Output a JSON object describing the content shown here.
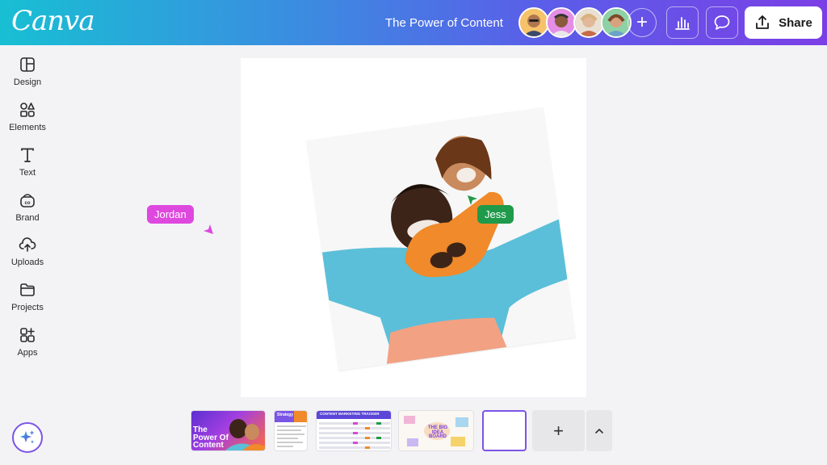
{
  "header": {
    "logo": "Canva",
    "doc_title": "The Power of Content",
    "add_collaborator": "+",
    "share_label": "Share",
    "icons": [
      "analytics-icon",
      "comment-icon",
      "upload-icon"
    ]
  },
  "collaborators": [
    {
      "ring": "#f2a13a",
      "skin": "#b0774f"
    },
    {
      "ring": "#d64bd6",
      "skin": "#8a5a3c"
    },
    {
      "ring": "#c9c2b8",
      "skin": "#e1b89a"
    },
    {
      "ring": "#1f9a4a",
      "skin": "#d9a27e"
    }
  ],
  "sidebar": {
    "items": [
      {
        "label": "Design",
        "icon": "layout-icon"
      },
      {
        "label": "Elements",
        "icon": "shapes-icon"
      },
      {
        "label": "Text",
        "icon": "text-icon"
      },
      {
        "label": "Brand",
        "icon": "brand-icon"
      },
      {
        "label": "Uploads",
        "icon": "cloud-upload-icon"
      },
      {
        "label": "Projects",
        "icon": "folder-icon"
      },
      {
        "label": "Apps",
        "icon": "apps-icon"
      }
    ],
    "magic_icon": "sparkle-icon"
  },
  "cursors": {
    "jordan": {
      "name": "Jordan",
      "color": "#de48de"
    },
    "jess": {
      "name": "Jess",
      "color": "#1f9a4a"
    }
  },
  "pages": {
    "thumb1_text": "The Power Of Content",
    "thumb2_text": "Strategy",
    "thumb3_text": "CONTENT MARKETING TRACKER",
    "thumb4_text": "THE BIG IDEA BOARD",
    "add_page": "+"
  }
}
